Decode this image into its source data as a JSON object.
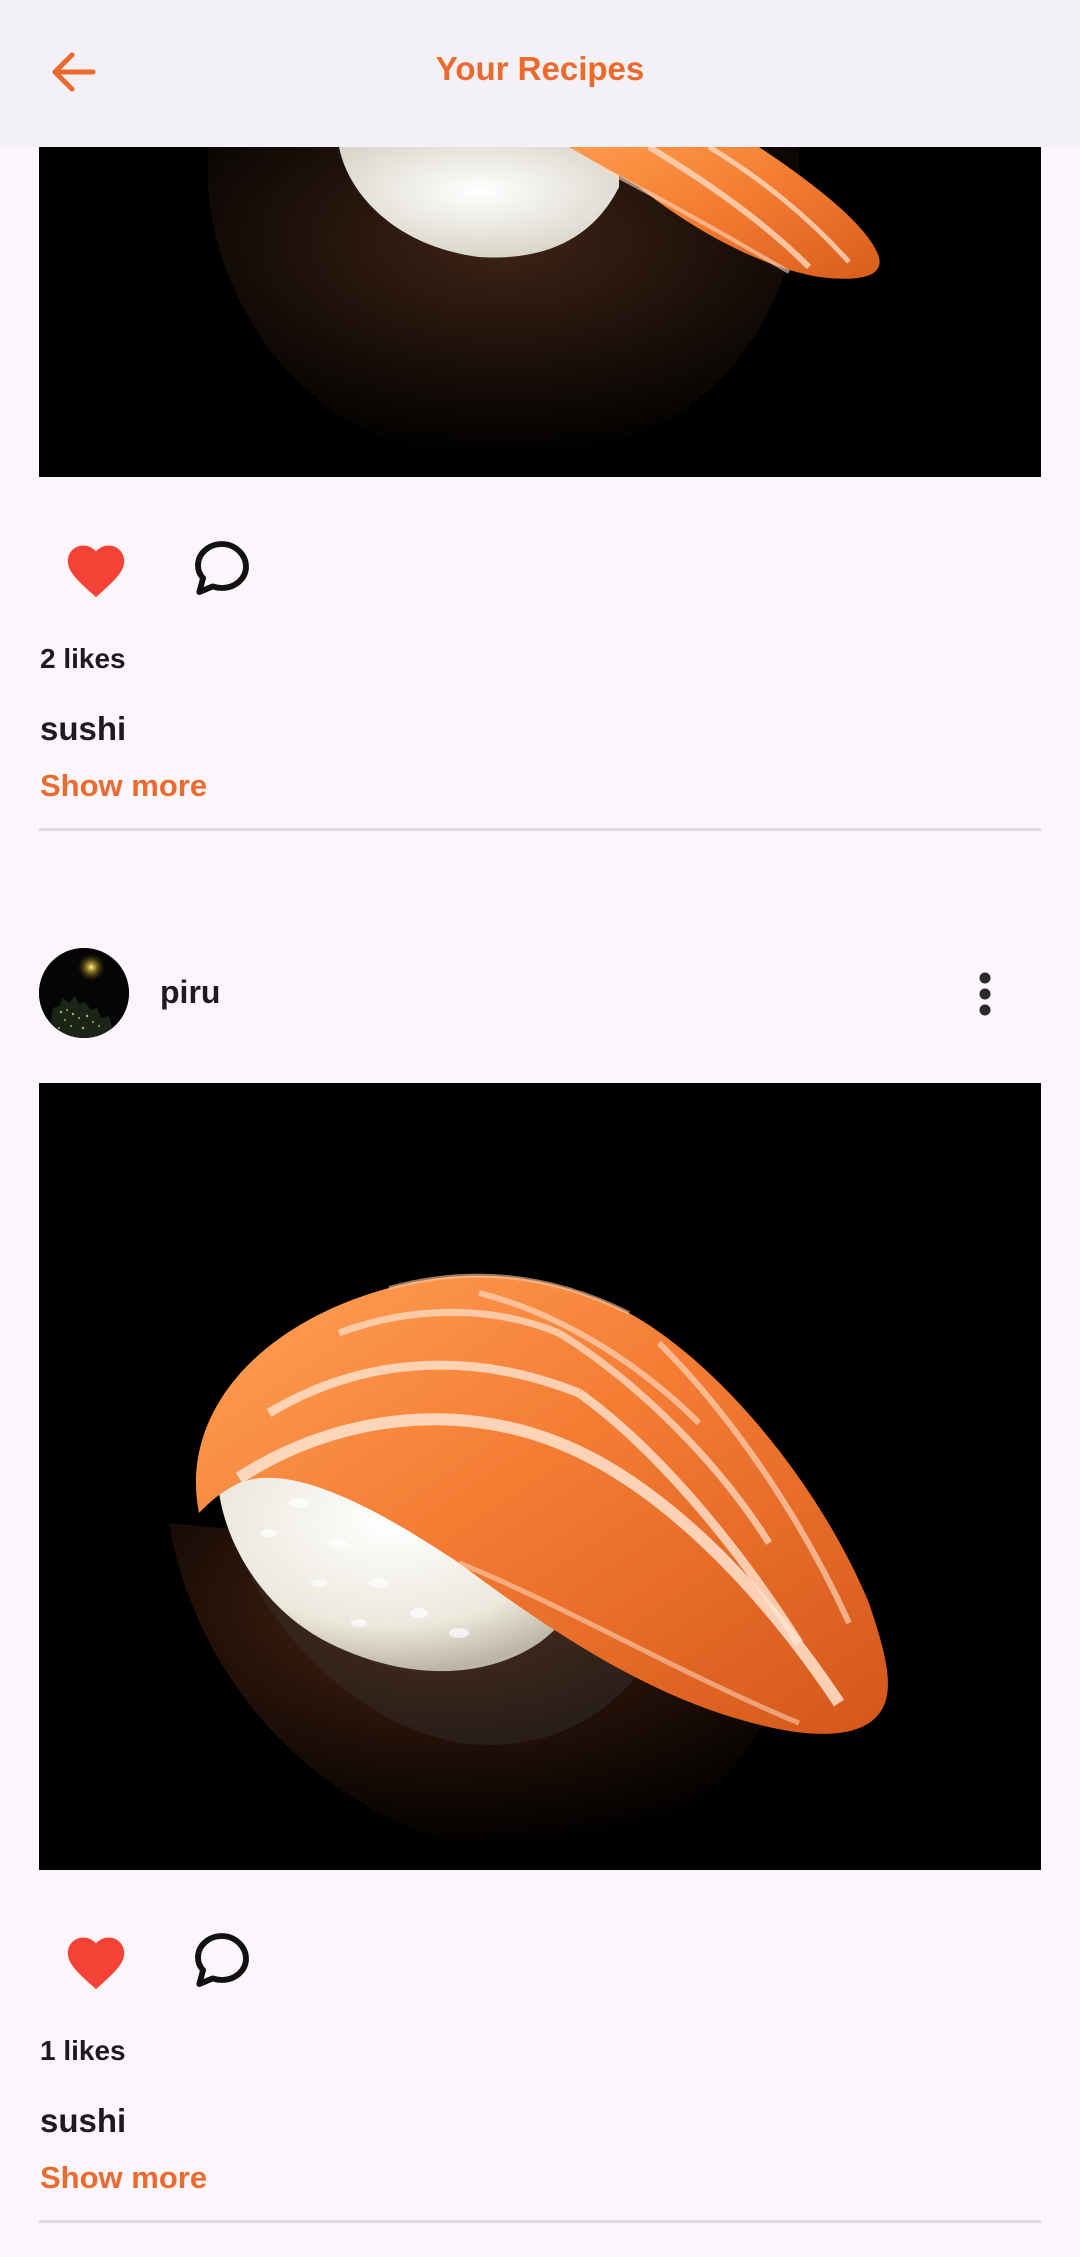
{
  "app_bar": {
    "title": "Your Recipes",
    "back_icon": "arrow-back-icon"
  },
  "colors": {
    "accent": "#ec6a2e",
    "like": "#f44336",
    "text": "#1d1b20",
    "background": "#fcf6fc",
    "appbar": "#f3f1f6",
    "divider": "#dcd9df"
  },
  "posts": [
    {
      "author": "",
      "image": "salmon-nigiri-sushi-photo",
      "liked": true,
      "likes_text": "2 likes",
      "caption": "sushi",
      "show_more": "Show more"
    },
    {
      "author": "piru",
      "avatar": "night-city-avatar",
      "image": "salmon-nigiri-sushi-photo",
      "liked": true,
      "likes_text": "1 likes",
      "caption": "sushi",
      "show_more": "Show more"
    }
  ]
}
